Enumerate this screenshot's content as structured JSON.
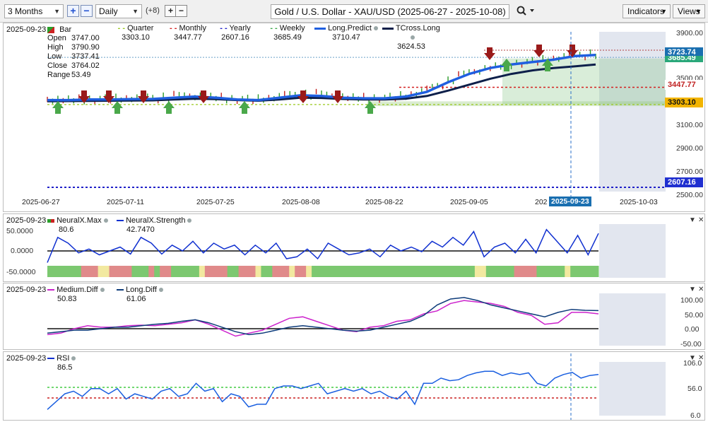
{
  "toolbar": {
    "timeframe": "3 Months",
    "interval": "Daily",
    "plus_count": "(+8)",
    "title": "Gold / U.S. Dollar - XAU/USD (2025-06-27 - 2025-10-08)",
    "indicators_label": "Indicators",
    "views_label": "Views"
  },
  "price_panel": {
    "date": "2025-09-23",
    "bar_label": "Bar",
    "ohlc": [
      {
        "label": "Open",
        "value": "3747.00"
      },
      {
        "label": "High",
        "value": "3790.90"
      },
      {
        "label": "Low",
        "value": "3737.41"
      },
      {
        "label": "Close",
        "value": "3764.02"
      },
      {
        "label": "Range",
        "value": "53.49"
      }
    ],
    "legend": [
      {
        "name": "Quarter",
        "value": "3303.10",
        "color": "#9ac81e"
      },
      {
        "name": "Monthly",
        "value": "3447.77",
        "color": "#d42020"
      },
      {
        "name": "Yearly",
        "value": "2607.16",
        "color": "#2020c8"
      },
      {
        "name": "Weekly",
        "value": "3685.49",
        "color": "#3aa84a"
      },
      {
        "name": "Long.Predict",
        "value": "3710.47",
        "color": "#1f5fe0"
      },
      {
        "name": "TCross.Long",
        "value": "3624.53",
        "color": "#0d1f4a"
      }
    ],
    "y_ticks": [
      "3900.00",
      "3500.00",
      "3100.00",
      "2900.00",
      "2700.00",
      "2500.00"
    ],
    "price_tags": {
      "current": "3723.74",
      "hidden": "3685.49",
      "monthly": "3447.77",
      "quarter": "3303.10",
      "yearly": "2607.16"
    },
    "x_ticks": [
      "2025-06-27",
      "2025-07-11",
      "2025-07-25",
      "2025-08-08",
      "2025-08-22",
      "2025-09-05",
      "2025-10-03"
    ],
    "x_partial": "202",
    "crosshair_date": "2025-09-23"
  },
  "neural_panel": {
    "date": "2025-09-23",
    "series": [
      {
        "name": "NeuralX.Max",
        "value": "80.6"
      },
      {
        "name": "NeuralX.Strength",
        "value": "42.7470"
      }
    ],
    "y_ticks": [
      "50.0000",
      "0.0000",
      "-50.0000"
    ]
  },
  "diff_panel": {
    "date": "2025-09-23",
    "series": [
      {
        "name": "Medium.Diff",
        "value": "50.83",
        "color": "#cc22cc"
      },
      {
        "name": "Long.Diff",
        "value": "61.06",
        "color": "#0d3b7a"
      }
    ],
    "y_ticks": [
      "100.00",
      "50.00",
      "0.00",
      "-50.00"
    ]
  },
  "rsi_panel": {
    "date": "2025-09-23",
    "series": [
      {
        "name": "RSI",
        "value": "86.5"
      }
    ],
    "y_ticks": [
      "106.0",
      "56.0",
      "6.0"
    ]
  },
  "chart_data": {
    "type": "line",
    "title": "Gold / U.S. Dollar - XAU/USD (2025-06-27 - 2025-10-08)",
    "xlabel": "",
    "ylabel": "",
    "x": [
      "2025-06-27",
      "2025-07-01",
      "2025-07-04",
      "2025-07-08",
      "2025-07-11",
      "2025-07-15",
      "2025-07-18",
      "2025-07-22",
      "2025-07-25",
      "2025-07-29",
      "2025-08-01",
      "2025-08-05",
      "2025-08-08",
      "2025-08-12",
      "2025-08-15",
      "2025-08-19",
      "2025-08-22",
      "2025-08-26",
      "2025-08-29",
      "2025-09-02",
      "2025-09-05",
      "2025-09-09",
      "2025-09-12",
      "2025-09-16",
      "2025-09-19",
      "2025-09-23",
      "2025-09-26"
    ],
    "series": [
      {
        "name": "Long.Predict",
        "values": [
          3340,
          3340,
          3345,
          3345,
          3348,
          3350,
          3360,
          3370,
          3360,
          3345,
          3340,
          3360,
          3380,
          3375,
          3360,
          3355,
          3355,
          3370,
          3410,
          3490,
          3560,
          3610,
          3640,
          3660,
          3680,
          3710,
          3720
        ]
      },
      {
        "name": "TCross.Long",
        "values": [
          3330,
          3332,
          3334,
          3335,
          3336,
          3338,
          3345,
          3352,
          3348,
          3340,
          3335,
          3345,
          3360,
          3358,
          3350,
          3345,
          3345,
          3352,
          3375,
          3420,
          3470,
          3520,
          3560,
          3590,
          3610,
          3624,
          3640
        ]
      }
    ],
    "ylim": [
      2500,
      3950
    ],
    "levels": {
      "Quarter": 3303.1,
      "Monthly": 3447.77,
      "Yearly": 2607.16,
      "Weekly": 3685.49
    }
  }
}
